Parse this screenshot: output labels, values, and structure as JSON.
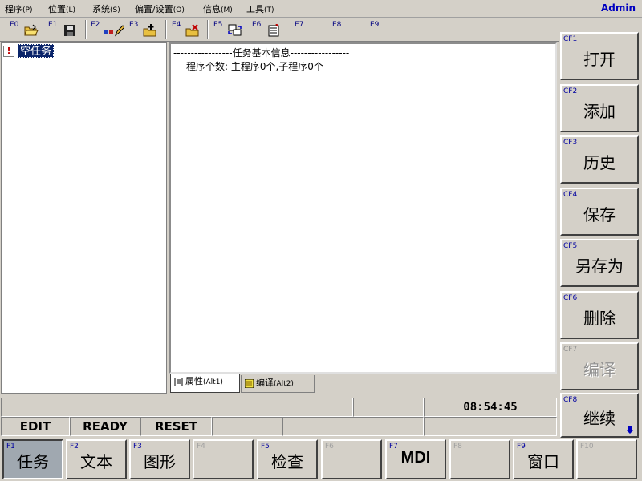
{
  "menu": {
    "items": [
      {
        "label": "程序",
        "shortcut": "(P)"
      },
      {
        "label": "位置",
        "shortcut": "(L)"
      },
      {
        "label": "系统",
        "shortcut": "(S)"
      },
      {
        "label": "偏置/设置",
        "shortcut": "(O)"
      },
      {
        "label": "信息",
        "shortcut": "(M)"
      },
      {
        "label": "工具",
        "shortcut": "(T)"
      }
    ],
    "user": "Admin"
  },
  "toolbar": {
    "keys": [
      "E0",
      "E1",
      "E2",
      "E3",
      "E4",
      "E5",
      "E6",
      "E7",
      "E8",
      "E9"
    ],
    "icons": [
      "open-folder-icon",
      "save-disk-icon",
      "edit-pen-icon",
      "add-folder-icon",
      "delete-folder-icon",
      "convert-icon",
      "paste-document-icon"
    ]
  },
  "tree": {
    "items": [
      {
        "label": "空任务",
        "icon": "warning-icon",
        "icon_glyph": "!"
      }
    ]
  },
  "info": {
    "line1": "-----------------任务基本信息-----------------",
    "line2": "程序个数: 主程序0个,子程序0个"
  },
  "tabs": [
    {
      "label": "属性",
      "shortcut": "(Alt1)",
      "active": true
    },
    {
      "label": "编译",
      "shortcut": "(Alt2)",
      "active": false
    }
  ],
  "side_buttons": [
    {
      "key": "CF1",
      "label": "打开",
      "enabled": true
    },
    {
      "key": "CF2",
      "label": "添加",
      "enabled": true
    },
    {
      "key": "CF3",
      "label": "历史",
      "enabled": true
    },
    {
      "key": "CF4",
      "label": "保存",
      "enabled": true
    },
    {
      "key": "CF5",
      "label": "另存为",
      "enabled": true
    },
    {
      "key": "CF6",
      "label": "删除",
      "enabled": true
    },
    {
      "key": "CF7",
      "label": "编译",
      "enabled": false
    },
    {
      "key": "CF8",
      "label": "继续",
      "enabled": true
    }
  ],
  "status": {
    "time": "08:54:45",
    "modes": [
      "EDIT",
      "READY",
      "RESET",
      "",
      "",
      ""
    ]
  },
  "fkeys": [
    {
      "key": "F1",
      "label": "任务",
      "pressed": true
    },
    {
      "key": "F2",
      "label": "文本"
    },
    {
      "key": "F3",
      "label": "图形"
    },
    {
      "key": "F4",
      "label": ""
    },
    {
      "key": "F5",
      "label": "检查"
    },
    {
      "key": "F6",
      "label": ""
    },
    {
      "key": "F7",
      "label": "MDI"
    },
    {
      "key": "F8",
      "label": ""
    },
    {
      "key": "F9",
      "label": "窗口"
    },
    {
      "key": "F10",
      "label": ""
    }
  ],
  "colors": {
    "face": "#d4d0c8",
    "selection": "#0a246a",
    "key_text": "#0000a0",
    "user_text": "#0000c0"
  }
}
